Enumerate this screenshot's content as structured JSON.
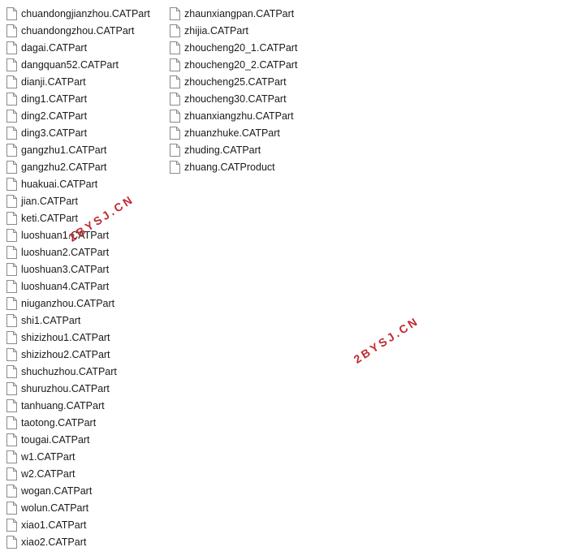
{
  "files_left": [
    "chuandongjianzhou.CATPart",
    "chuandongzhou.CATPart",
    "dagai.CATPart",
    "dangquan52.CATPart",
    "dianji.CATPart",
    "ding1.CATPart",
    "ding2.CATPart",
    "ding3.CATPart",
    "gangzhu1.CATPart",
    "gangzhu2.CATPart",
    "huakuai.CATPart",
    "jian.CATPart",
    "keti.CATPart",
    "luoshuan1.CATPart",
    "luoshuan2.CATPart",
    "luoshuan3.CATPart",
    "luoshuan4.CATPart",
    "niuganzhou.CATPart",
    "shi1.CATPart",
    "shizizhou1.CATPart",
    "shizizhou2.CATPart",
    "shuchuzhou.CATPart",
    "shuruzhou.CATPart",
    "tanhuang.CATPart",
    "taotong.CATPart",
    "tougai.CATPart",
    "w1.CATPart",
    "w2.CATPart",
    "wogan.CATPart",
    "wolun.CATPart",
    "xiao1.CATPart",
    "xiao2.CATPart"
  ],
  "files_right": [
    "zhaunxiangpan.CATPart",
    "zhijia.CATPart",
    "zhoucheng20_1.CATPart",
    "zhoucheng20_2.CATPart",
    "zhoucheng25.CATPart",
    "zhoucheng30.CATPart",
    "zhuanxiangzhu.CATPart",
    "zhuanzhuke.CATPart",
    "zhuding.CATPart",
    "zhuang.CATProduct"
  ],
  "file_icon": "document-icon",
  "watermarks": [
    "2BYSJ.CN",
    "2BYSJ.CN"
  ],
  "colors": {
    "text": "#1a1a1a",
    "watermark": "#c0282d",
    "icon_stroke": "#8a8a8a"
  }
}
